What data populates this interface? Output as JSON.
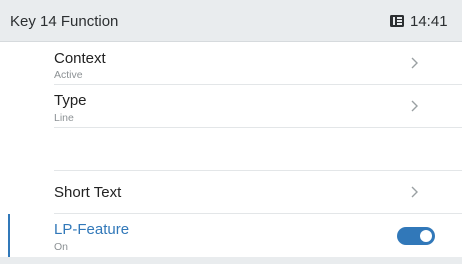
{
  "header": {
    "title": "Key 14 Function",
    "time": "14:41",
    "status_icon": "phone-list-icon"
  },
  "items": [
    {
      "label": "Context",
      "sub": "Active",
      "icon": "chevron-right-icon"
    },
    {
      "label": "Type",
      "sub": "Line",
      "icon": "chevron-right-icon"
    },
    {
      "label": "",
      "sub": ""
    },
    {
      "label": "Short Text",
      "sub": "",
      "icon": "chevron-right-icon"
    },
    {
      "label": "LP-Feature",
      "sub": "On",
      "toggle_on": true
    }
  ],
  "colors": {
    "accent": "#3178b9",
    "header_bg": "#e9ecee",
    "divider": "#e3e6e8",
    "subtext": "#8c9194"
  }
}
